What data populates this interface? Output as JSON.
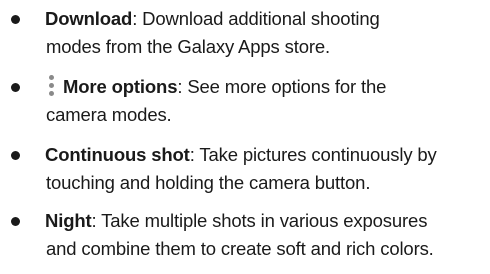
{
  "items": [
    {
      "term": "Download",
      "line1_text": ": Download additional shooting",
      "line2_text": "modes from the Galaxy Apps store."
    },
    {
      "icon": "more-options-vertical-dots-icon",
      "term": "More options",
      "line1_text": ": See more options for the",
      "line2_text": "camera modes."
    },
    {
      "term": "Continuous shot",
      "line1_text": ": Take pictures continuously by",
      "line2_text": "touching and holding the camera button."
    },
    {
      "term": "Night",
      "line1_text": ": Take multiple shots in various exposures",
      "line2_text": "and combine them to create soft and rich colors."
    }
  ]
}
